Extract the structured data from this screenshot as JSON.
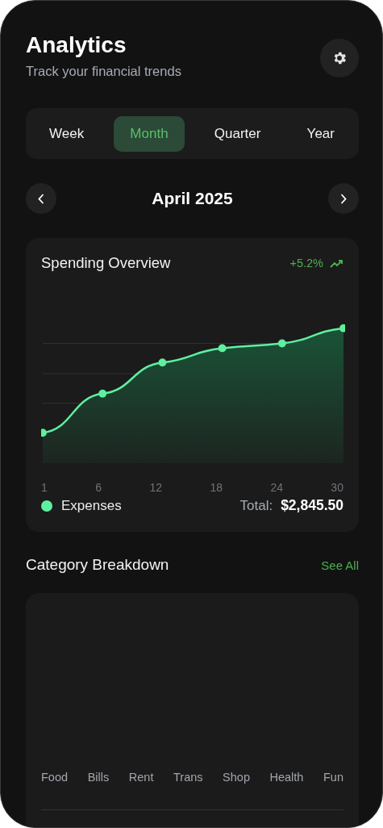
{
  "header": {
    "title": "Analytics",
    "subtitle": "Track your financial trends"
  },
  "periods": [
    {
      "label": "Week",
      "selected": false
    },
    {
      "label": "Month",
      "selected": true
    },
    {
      "label": "Quarter",
      "selected": false
    },
    {
      "label": "Year",
      "selected": false
    }
  ],
  "date_nav": {
    "label": "April 2025"
  },
  "spending": {
    "title": "Spending Overview",
    "change": "+5.2%",
    "x_labels": [
      "1",
      "6",
      "12",
      "18",
      "24",
      "30"
    ],
    "legend": "Expenses",
    "total_label": "Total:",
    "total_value": "$2,845.50"
  },
  "categories": {
    "title": "Category Breakdown",
    "link": "See All",
    "labels": [
      "Food",
      "Bills",
      "Rent",
      "Trans",
      "Shop",
      "Health",
      "Fun"
    ]
  }
}
